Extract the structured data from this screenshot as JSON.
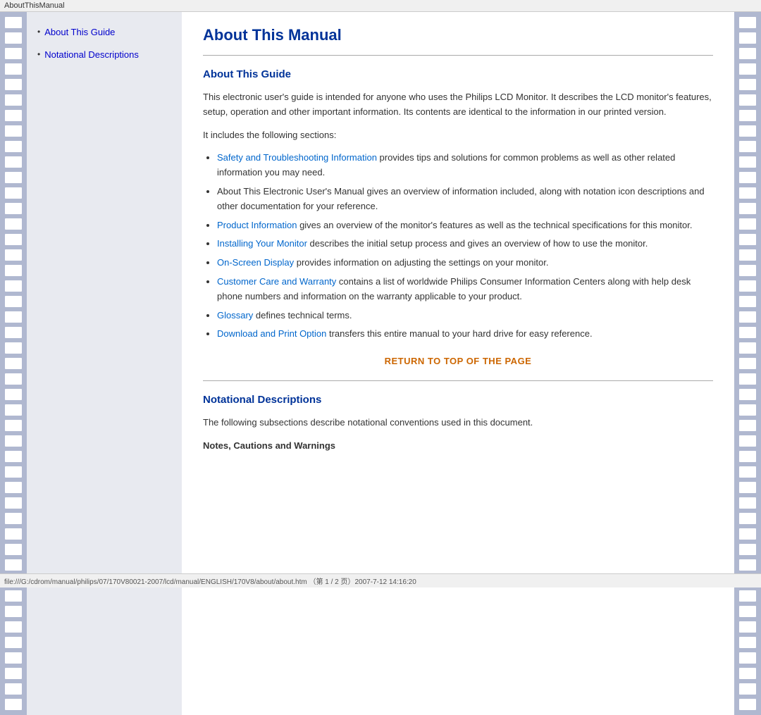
{
  "titleBar": {
    "text": "AboutThisManual"
  },
  "sidebar": {
    "items": [
      {
        "id": "about-guide",
        "label": "About This Guide"
      },
      {
        "id": "notational-descriptions",
        "label": "Notational Descriptions"
      }
    ]
  },
  "main": {
    "pageTitle": "About This Manual",
    "sections": [
      {
        "id": "about-guide",
        "heading": "About This Guide",
        "intro": "This electronic user's guide is intended for anyone who uses the Philips LCD Monitor. It describes the LCD monitor's features, setup, operation and other important information. Its contents are identical to the information in our printed version.",
        "followText": "It includes the following sections:",
        "listItems": [
          {
            "linkText": "Safety and Troubleshooting Information",
            "restText": " provides tips and solutions for common problems as well as other related information you may need.",
            "hasLink": true
          },
          {
            "linkText": "",
            "restText": "About This Electronic User's Manual gives an overview of information included, along with notation icon descriptions and other documentation for your reference.",
            "hasLink": false
          },
          {
            "linkText": "Product Information",
            "restText": " gives an overview of the monitor's features as well as the technical specifications for this monitor.",
            "hasLink": true
          },
          {
            "linkText": "Installing Your Monitor",
            "restText": " describes the initial setup process and gives an overview of how to use the monitor.",
            "hasLink": true
          },
          {
            "linkText": "On-Screen Display",
            "restText": " provides information on adjusting the settings on your monitor.",
            "hasLink": true
          },
          {
            "linkText": "Customer Care and Warranty",
            "restText": " contains a list of worldwide Philips Consumer Information Centers along with help desk phone numbers and information on the warranty applicable to your product.",
            "hasLink": true
          },
          {
            "linkText": "Glossary",
            "restText": " defines technical terms.",
            "hasLink": true
          },
          {
            "linkText": "Download and Print Option",
            "restText": " transfers this entire manual to your hard drive for easy reference.",
            "hasLink": true
          }
        ],
        "returnLink": "RETURN TO TOP OF THE PAGE"
      },
      {
        "id": "notational-descriptions",
        "heading": "Notational Descriptions",
        "intro": "The following subsections describe notational conventions used in this document.",
        "subheading": "Notes, Cautions and Warnings"
      }
    ]
  },
  "statusBar": {
    "text": "file:///G:/cdrom/manual/philips/07/170V80021-2007/lcd/manual/ENGLISH/170V8/about/about.htm  （第 1 / 2 页）2007-7-12 14:16:20"
  }
}
